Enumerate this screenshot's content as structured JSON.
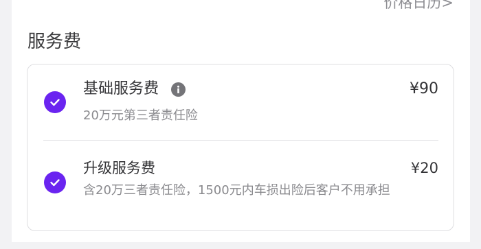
{
  "header": {
    "price_history_link": "价格日历>"
  },
  "section": {
    "title": "服务费"
  },
  "services": [
    {
      "name": "基础服务费",
      "price": "¥90",
      "description": "20万元第三者责任险",
      "checked": true,
      "has_info_icon": true
    },
    {
      "name": "升级服务费",
      "price": "¥20",
      "description": "含20万三者责任险，1500元内车损出险后客户不用承担",
      "checked": true,
      "has_info_icon": false
    }
  ],
  "colors": {
    "accent": "#6a24f0",
    "info_icon": "#747478",
    "text_primary": "#333336",
    "text_secondary": "#8a8a8e",
    "background": "#f2f2f4"
  },
  "icons": {
    "check": "check-icon",
    "info": "info-icon"
  }
}
